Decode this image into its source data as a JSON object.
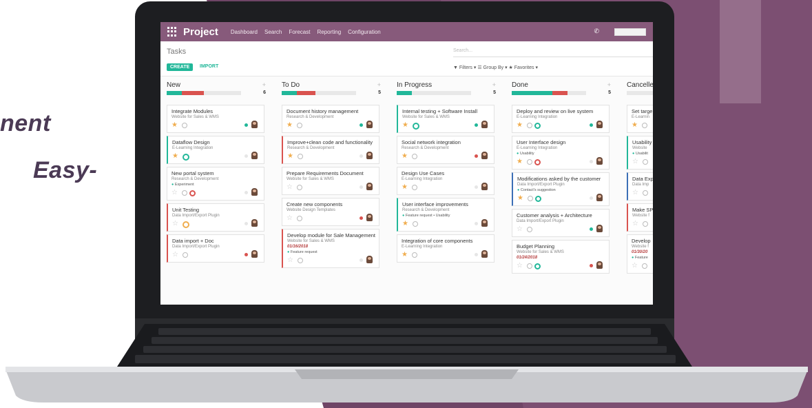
{
  "hero": {
    "line1": "nent",
    "line2": "Easy-"
  },
  "app": {
    "title": "Project",
    "menu": [
      "Dashboard",
      "Search",
      "Forecast",
      "Reporting",
      "Configuration"
    ],
    "breadcrumb": "Tasks",
    "search_placeholder": "Search...",
    "create_label": "CREATE",
    "import_label": "IMPORT",
    "filters_label": "▼ Filters ▾   ☰ Group By ▾   ★ Favorites ▾"
  },
  "colors": {
    "brand": "#875a7b",
    "accent": "#21b799",
    "danger": "#d9534f",
    "warning": "#f0ad4e"
  },
  "columns": [
    {
      "name": "New",
      "count": "6",
      "progress": {
        "green": 0.2,
        "red": 0.3,
        "grey": 0.5
      },
      "cards": [
        {
          "title": "Integrate Modules",
          "sub": "Website for Sales & WMS",
          "star": true,
          "dot": "#21b799"
        },
        {
          "title": "Dataflow Design",
          "sub": "E-Learning Integration",
          "star": true,
          "clock": "green",
          "dot": "#e6e6e6",
          "hl": "green"
        },
        {
          "title": "New portal system",
          "sub": "Research & Development",
          "tag": "Experiment",
          "star": false,
          "clock2": "red",
          "dot": "#e6e6e6"
        },
        {
          "title": "Unit Testing",
          "sub": "Data Import/Export Plugin",
          "star": false,
          "clock": "orange",
          "dot": "#e6e6e6",
          "hl": "red"
        },
        {
          "title": "Data import + Doc",
          "sub": "Data Import/Export Plugin",
          "star": false,
          "dot": "#d9534f",
          "hl": "red"
        }
      ]
    },
    {
      "name": "To Do",
      "count": "5",
      "progress": {
        "green": 0.2,
        "red": 0.25,
        "grey": 0.55
      },
      "cards": [
        {
          "title": "Document history management",
          "sub": "Research & Development",
          "star": true,
          "dot": "#21b799"
        },
        {
          "title": "Improve+clean code and functionality",
          "sub": "Research & Development",
          "star": true,
          "dot": "#e6e6e6",
          "hl": "red"
        },
        {
          "title": "Prepare Requirements Document",
          "sub": "Website for Sales & WMS",
          "star": false,
          "dot": "#e6e6e6"
        },
        {
          "title": "Create new components",
          "sub": "Website Design Templates",
          "star": false,
          "dot": "#d9534f"
        },
        {
          "title": "Develop module for Sale Management",
          "sub": "Website for Sales & WMS",
          "date": "01/16/2018",
          "tag": "Feature request",
          "star": false,
          "dot": "#e6e6e6",
          "hl": "red"
        }
      ]
    },
    {
      "name": "In Progress",
      "count": "5",
      "progress": {
        "green": 0.2,
        "red": 0.0,
        "grey": 0.8
      },
      "cards": [
        {
          "title": "Internal testing + Software Install",
          "sub": "Website for Sales & WMS",
          "star": true,
          "clock": "green",
          "dot": "#21b799",
          "hl": "green"
        },
        {
          "title": "Social network integration",
          "sub": "Research & Development",
          "star": true,
          "dot": "#d9534f"
        },
        {
          "title": "Design Use Cases",
          "sub": "E-Learning Integration",
          "star": true,
          "dot": "#e6e6e6"
        },
        {
          "title": "User interface improvements",
          "sub": "Research & Development",
          "tag": "Feature request • Usability",
          "star": true,
          "dot": "#e6e6e6",
          "hl": "green"
        },
        {
          "title": "Integration of core components",
          "sub": "E-Learning Integration",
          "star": true,
          "dot": "#e6e6e6"
        }
      ]
    },
    {
      "name": "Done",
      "count": "5",
      "progress": {
        "green": 0.55,
        "red": 0.2,
        "grey": 0.25
      },
      "cards": [
        {
          "title": "Deploy and review on live system",
          "sub": "E-Learning Integration",
          "star": true,
          "clock2": "green",
          "dot": "#21b799"
        },
        {
          "title": "User Interface design",
          "sub": "E-Learning Integration",
          "tag": "Usability",
          "star": true,
          "clock2": "red",
          "dot": "#e6e6e6"
        },
        {
          "title": "Modifications asked by the customer",
          "sub": "Data Import/Export Plugin",
          "tag": "Contact's suggestion",
          "star": true,
          "clock2": "green",
          "dot": "#e6e6e6",
          "hl": "blue"
        },
        {
          "title": "Customer analysis + Architecture",
          "sub": "Data Import/Export Plugin",
          "star": false,
          "dot": "#21b799"
        },
        {
          "title": "Budget Planning",
          "sub": "Website for Sales & WMS",
          "date": "01/24/2018",
          "star": false,
          "clock2": "green",
          "dot": "#d9534f"
        }
      ]
    },
    {
      "name": "Cancelle",
      "count": "",
      "progress": {
        "green": 0.0,
        "red": 0.0,
        "grey": 1.0
      },
      "cards": [
        {
          "title": "Set targe",
          "sub": "E-Learnin",
          "star": true,
          "dot": "#e6e6e6"
        },
        {
          "title": "Usability",
          "sub": "Website",
          "tag": "Usabilit",
          "star": false,
          "dot": "#e6e6e6",
          "hl": "green"
        },
        {
          "title": "Data Exp",
          "sub": "Data Imp",
          "star": false,
          "dot": "#e6e6e6",
          "hl": "blue"
        },
        {
          "title": "Make SP",
          "sub": "Website f",
          "star": false,
          "dot": "#e6e6e6",
          "hl": "red"
        },
        {
          "title": "Develop",
          "sub": "Website f",
          "date": "01/30/20",
          "tag": "Feature",
          "star": false,
          "dot": "#e6e6e6"
        }
      ]
    }
  ]
}
